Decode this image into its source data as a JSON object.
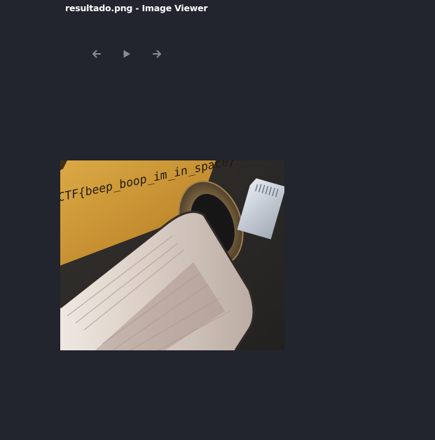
{
  "window": {
    "title": "resultado.png - Image Viewer"
  },
  "toolbar": {
    "prev": {
      "icon": "arrow-left-icon"
    },
    "play": {
      "icon": "play-icon"
    },
    "next": {
      "icon": "arrow-right-icon"
    }
  },
  "image": {
    "handwritten_text": "CTF{beep_boop_im_in_space}"
  },
  "colors": {
    "background": "#22242e",
    "title_text": "#ffffff",
    "icon": "#8a8c94"
  }
}
